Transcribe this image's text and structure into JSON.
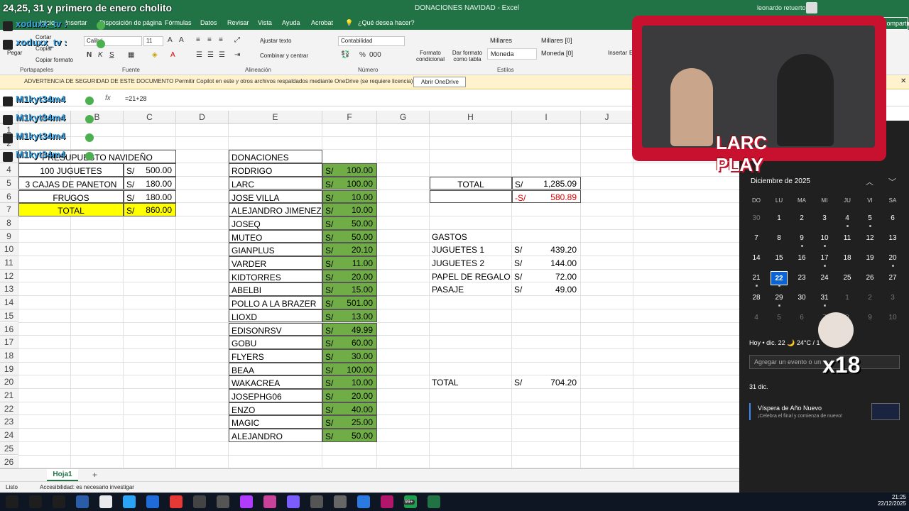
{
  "title": {
    "stream_title": "24,25, 31 y primero de enero cholito",
    "document": "DONACIONES NAVIDAD  -  Excel",
    "user": "leonardo retuerto"
  },
  "tabs": {
    "items": [
      "Inicio",
      "Insertar",
      "Disposición de página",
      "Fórmulas",
      "Datos",
      "Revisar",
      "Vista",
      "Ayuda",
      "Acrobat"
    ],
    "tell_me": "¿Qué desea hacer?",
    "share": "Compartir"
  },
  "ribbon": {
    "clipboard": {
      "paste": "Pegar",
      "cut": "Cortar",
      "copy": "Copiar",
      "format_painter": "Copiar formato",
      "group": "Portapapeles"
    },
    "font": {
      "name": "Calibri",
      "size": "11",
      "group": "Fuente"
    },
    "alignment": {
      "wrap": "Ajustar texto",
      "merge": "Combinar y centrar",
      "group": "Alineación"
    },
    "number": {
      "format": "Contabilidad",
      "group": "Número"
    },
    "styles": {
      "conditional": "Formato condicional",
      "as_table": "Dar formato como tabla",
      "cells": [
        "Millares",
        "Millares [0]",
        "Moneda",
        "Moneda [0]"
      ],
      "group": "Estilos"
    },
    "cells": {
      "insert": "Insertar",
      "delete": "Eli"
    }
  },
  "infobar": {
    "message": "ADVERTENCIA DE SEGURIDAD DE ESTE DOCUMENTO    Permitir Copilot en este y otros archivos respaldados mediante OneDrive (se requiere licencia).",
    "button": "Abrir OneDrive"
  },
  "formula_bar": {
    "fx": "fx",
    "formula": "=21+28"
  },
  "grid": {
    "columns": [
      "A",
      "B",
      "C",
      "D",
      "E",
      "F",
      "G",
      "H",
      "I",
      "J"
    ],
    "rows": [
      "1",
      "2",
      "3",
      "4",
      "5",
      "6",
      "7",
      "8",
      "9",
      "10",
      "11",
      "12",
      "13",
      "14",
      "15",
      "16",
      "17",
      "18",
      "19",
      "20",
      "21",
      "22",
      "23",
      "24",
      "25",
      "26"
    ],
    "budget": {
      "title": "PRESUPUESTO NAVIDEÑO",
      "items": [
        {
          "label": "100 JUGUETES",
          "cur": "S/",
          "amount": "500.00"
        },
        {
          "label": "3 CAJAS DE PANETON",
          "cur": "S/",
          "amount": "180.00"
        },
        {
          "label": "FRUGOS",
          "cur": "S/",
          "amount": "180.00"
        }
      ],
      "total_label": "TOTAL",
      "total_cur": "S/",
      "total": "860.00"
    },
    "donations": {
      "title": "DONACIONES",
      "items": [
        {
          "name": "RODRIGO",
          "cur": "S/",
          "amount": "100.00"
        },
        {
          "name": "LARC",
          "cur": "S/",
          "amount": "100.00"
        },
        {
          "name": "JOSE VILLA",
          "cur": "S/",
          "amount": "10.00"
        },
        {
          "name": "ALEJANDRO JIMENEZ",
          "cur": "S/",
          "amount": "10.00"
        },
        {
          "name": "JOSEQ",
          "cur": "S/",
          "amount": "50.00"
        },
        {
          "name": "MUTEO",
          "cur": "S/",
          "amount": "50.00"
        },
        {
          "name": "GIANPLUS",
          "cur": "S/",
          "amount": "20.10"
        },
        {
          "name": "VARDER",
          "cur": "S/",
          "amount": "11.00"
        },
        {
          "name": "KIDTORRES",
          "cur": "S/",
          "amount": "20.00"
        },
        {
          "name": "ABELBI",
          "cur": "S/",
          "amount": "15.00"
        },
        {
          "name": "POLLO A LA BRAZER",
          "cur": "S/",
          "amount": "501.00"
        },
        {
          "name": "LIOXD",
          "cur": "S/",
          "amount": "13.00"
        },
        {
          "name": "EDISONRSV",
          "cur": "S/",
          "amount": "49.99"
        },
        {
          "name": "GOBU",
          "cur": "S/",
          "amount": "60.00"
        },
        {
          "name": "FLYERS",
          "cur": "S/",
          "amount": "30.00"
        },
        {
          "name": "BEAA",
          "cur": "S/",
          "amount": "100.00"
        },
        {
          "name": "WAKACREA",
          "cur": "S/",
          "amount": "10.00"
        },
        {
          "name": "JOSEPHG06",
          "cur": "S/",
          "amount": "20.00"
        },
        {
          "name": "ENZO",
          "cur": "S/",
          "amount": "40.00"
        },
        {
          "name": "MAGIC",
          "cur": "S/",
          "amount": "25.00"
        },
        {
          "name": "ALEJANDRO",
          "cur": "S/",
          "amount": "50.00"
        }
      ]
    },
    "summary": {
      "total_label": "TOTAL",
      "total_cur": "S/",
      "total": "1,285.09",
      "diff_cur": "-S/",
      "diff": "580.89"
    },
    "expenses": {
      "title": "GASTOS",
      "items": [
        {
          "label": "JUGUETES 1",
          "cur": "S/",
          "amount": "439.20"
        },
        {
          "label": "JUGUETES 2",
          "cur": "S/",
          "amount": "144.00"
        },
        {
          "label": "PAPEL DE REGALO",
          "cur": "S/",
          "amount": "72.00"
        },
        {
          "label": "PASAJE",
          "cur": "S/",
          "amount": "49.00"
        }
      ],
      "total_label": "TOTAL",
      "total_cur": "S/",
      "total": "704.20"
    }
  },
  "sheet": {
    "tab": "Hoja1",
    "add": "+"
  },
  "status": {
    "ready": "Listo",
    "accessibility": "Accesibilidad: es necesario investigar"
  },
  "calendar": {
    "month": "Diciembre de 2025",
    "weekdays": [
      "DO",
      "LU",
      "MA",
      "MI",
      "JU",
      "VI",
      "SA"
    ],
    "days": [
      "30",
      "1",
      "2",
      "3",
      "4",
      "5",
      "6",
      "7",
      "8",
      "9",
      "10",
      "11",
      "12",
      "13",
      "14",
      "15",
      "16",
      "17",
      "18",
      "19",
      "20",
      "21",
      "22",
      "23",
      "24",
      "25",
      "26",
      "27",
      "28",
      "29",
      "30",
      "31",
      "1",
      "2",
      "3",
      "4",
      "5",
      "6",
      "7",
      "8",
      "9",
      "10"
    ],
    "today": "Hoy • dic. 22  🌙 24°C / 1",
    "add_event": "Agregar un evento o un",
    "date_header": "31 dic.",
    "event_title": "Víspera de Año Nuevo",
    "event_sub": "¡Celebra el final y comienza de nuevo!"
  },
  "overlay": {
    "handles": [
      "xoduxx_tv :",
      "xoduxx_tv :",
      "M1kyt34m4",
      "M1kyt34m4",
      "M1kyt34m4",
      "M1kyt34m4"
    ],
    "logo_line1": "LARC",
    "logo_line2": "PLAY",
    "counter": "x18"
  },
  "taskbar": {
    "time": "21:25",
    "date": "22/12/2025",
    "badge": "99+"
  },
  "colors": {
    "excel_green": "#217346",
    "donation_fill": "#70ad47",
    "total_fill": "#ffff00",
    "negative": "#e00000",
    "today": "#0a64d8"
  }
}
